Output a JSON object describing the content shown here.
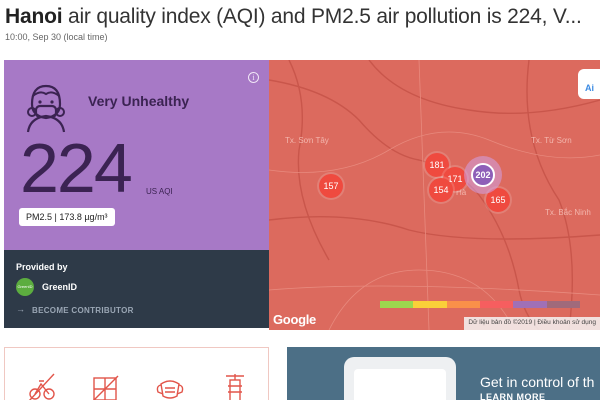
{
  "header": {
    "city": "Hanoi",
    "title_rest": " air quality index (AQI) and PM2.5 air pollution is 224, V...",
    "timestamp": "10:00, Sep 30 (local time)"
  },
  "aqi": {
    "category": "Very Unhealthy",
    "value": "224",
    "unit": "US AQI",
    "pollutant": "PM2.5 | 173.8 µg/m³",
    "panel_color": "#a779c6",
    "icon": "face-mask-icon",
    "info_icon": "info-icon",
    "info_glyph": "i"
  },
  "provider": {
    "label": "Provided by",
    "name": "GreenID",
    "logo_text": "GreenID",
    "contributor_arrow": "→",
    "contributor_label": "BECOME CONTRIBUTOR"
  },
  "map": {
    "places": [
      "Tx. Sơn Tây",
      "Tx. Từ Sơn",
      "Hà",
      "Tx. Bắc Ninh"
    ],
    "markers": [
      "181",
      "171",
      "154",
      "157",
      "165"
    ],
    "main_marker": "202",
    "brand_logo": "Google",
    "airvisual_label": "Ai",
    "footer": "Dữ liệu bản đồ ©2019 | Điều khoản sử dụng",
    "scale_colors": [
      "#9cd84e",
      "#facf39",
      "#f99049",
      "#f65e5f",
      "#a070b6",
      "#a06a7b"
    ],
    "background_color": "#dc6a5e"
  },
  "promo": {
    "title": "Get in control of th",
    "link": "LEARN MORE"
  },
  "tips": {
    "icons": [
      "no-outdoor-exercise-icon",
      "close-windows-icon",
      "wear-mask-icon",
      "air-purifier-icon"
    ]
  }
}
